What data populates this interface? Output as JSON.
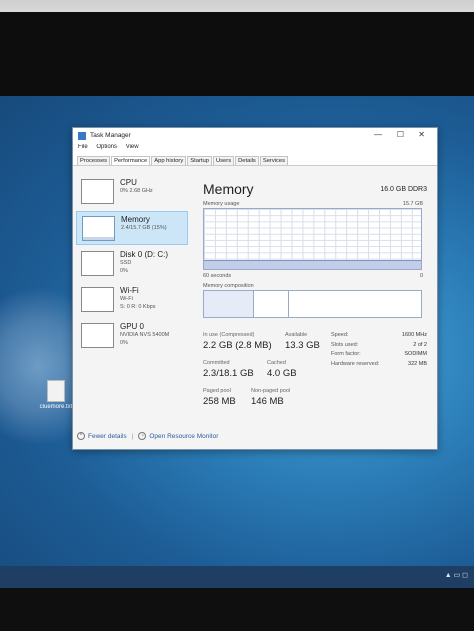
{
  "window": {
    "title": "Task Manager",
    "minimize": "—",
    "maximize": "☐",
    "close": "✕"
  },
  "menu": [
    "File",
    "Options",
    "View"
  ],
  "tabs": [
    "Processes",
    "Performance",
    "App history",
    "Startup",
    "Users",
    "Details",
    "Services"
  ],
  "active_tab": "Performance",
  "sidebar": [
    {
      "name": "CPU",
      "line1": "0% 2.68 GHz",
      "line2": ""
    },
    {
      "name": "Memory",
      "line1": "2.4/15.7 GB (15%)",
      "line2": ""
    },
    {
      "name": "Disk 0 (D: C:)",
      "line1": "SSD",
      "line2": "0%"
    },
    {
      "name": "Wi-Fi",
      "line1": "Wi-Fi",
      "line2": "S: 0 R: 0 Kbps"
    },
    {
      "name": "GPU 0",
      "line1": "NVIDIA NVS 5400M",
      "line2": "0%"
    }
  ],
  "memory": {
    "title": "Memory",
    "capacity": "16.0 GB DDR3",
    "usage_label": "Memory usage",
    "usage_max": "15.7 GB",
    "time_label": "60 seconds",
    "time_zero": "0",
    "composition_label": "Memory composition",
    "usage_fraction": 0.15,
    "stats": {
      "in_use_label": "In use (Compressed)",
      "in_use": "2.2 GB (2.8 MB)",
      "available_label": "Available",
      "available": "13.3 GB",
      "committed_label": "Committed",
      "committed": "2.3/18.1 GB",
      "cached_label": "Cached",
      "cached": "4.0 GB",
      "paged_label": "Paged pool",
      "paged": "258 MB",
      "nonpaged_label": "Non-paged pool",
      "nonpaged": "146 MB"
    },
    "hardware": [
      {
        "k": "Speed:",
        "v": "1600 MHz"
      },
      {
        "k": "Slots used:",
        "v": "2 of 2"
      },
      {
        "k": "Form factor:",
        "v": "SODIMM"
      },
      {
        "k": "Hardware reserved:",
        "v": "322 MB"
      }
    ]
  },
  "footer": {
    "fewer": "Fewer details",
    "monitor": "Open Resource Monitor",
    "separator": "|"
  },
  "desktop_icon": {
    "label": "cluemore.txt"
  },
  "colors": {
    "accent": "#cde6f7",
    "graph_line": "#7c92c2",
    "desktop": "#2b7db8"
  }
}
